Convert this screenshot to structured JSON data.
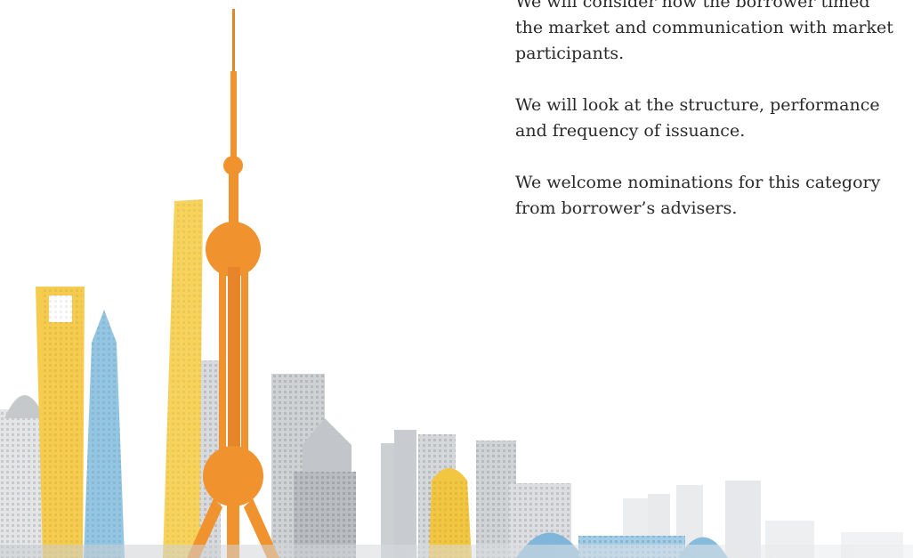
{
  "paragraphs": [
    "We will consider how the borrower timed the market and communication with market participants.",
    "We will look at the structure, performance and frequency of issuance.",
    "We welcome nominations for this category from borrower’s advisers."
  ],
  "colors": {
    "tower_orange": "#f0922e",
    "accent_yellow": "#f7d35c",
    "accent_blue": "#8ec2e0",
    "building_grey": "#d3d5d8",
    "text": "#2a2a2a"
  },
  "illustration": {
    "subject": "city-skyline-illustration",
    "landmark": "tv-tower"
  }
}
